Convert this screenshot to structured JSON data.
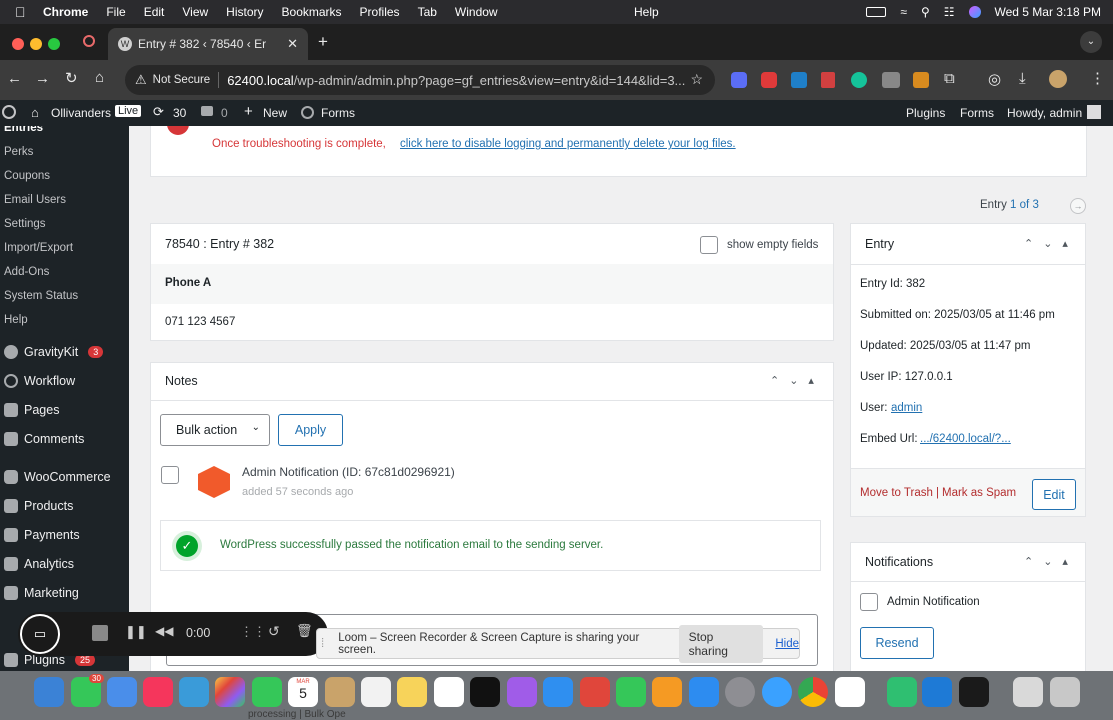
{
  "menubar": {
    "app_name": "Chrome",
    "items": [
      "File",
      "Edit",
      "View",
      "History",
      "Bookmarks",
      "Profiles",
      "Tab",
      "Window"
    ],
    "help": "Help",
    "datetime": "Wed 5 Mar  3:18 PM"
  },
  "browser": {
    "tab_title": "Entry # 382 ‹ 78540 ‹ Er",
    "security_label": "Not Secure",
    "url_host": "62400.local",
    "url_path": "/wp-admin/admin.php?page=gf_entries&view=entry&id=144&lid=3..."
  },
  "adminbar": {
    "site_name": "Ollivanders",
    "live_badge": "Live",
    "updates_count": "30",
    "comments_count": "0",
    "new_label": "New",
    "forms_label": "Forms",
    "right_plugins": "Plugins",
    "right_forms": "Forms",
    "howdy": "Howdy, admin"
  },
  "sidebar": {
    "submenu_current": "Entries",
    "submenu": [
      "Perks",
      "Coupons",
      "Email Users",
      "Settings",
      "Import/Export",
      "Add-Ons",
      "System Status",
      "Help"
    ],
    "menu": [
      {
        "label": "GravityKit",
        "badge": "3"
      },
      {
        "label": "Workflow",
        "badge": ""
      },
      {
        "label": "Pages",
        "badge": ""
      },
      {
        "label": "Comments",
        "badge": ""
      },
      {
        "label": "WooCommerce",
        "badge": ""
      },
      {
        "label": "Products",
        "badge": ""
      },
      {
        "label": "Payments",
        "badge": ""
      },
      {
        "label": "Analytics",
        "badge": ""
      },
      {
        "label": "Marketing",
        "badge": ""
      },
      {
        "label": "Plugins",
        "badge": "25"
      }
    ]
  },
  "notice": {
    "text": "Once troubleshooting is complete,",
    "link": "click here to disable logging and permanently delete your log files."
  },
  "pagination": {
    "prefix": "Entry",
    "current": "1",
    "of": "of",
    "total": "3"
  },
  "entry_box": {
    "title": "78540 : Entry # 382",
    "show_empty": "show empty fields",
    "field_label": "Phone A",
    "field_value": "071 123 4567"
  },
  "notes": {
    "title": "Notes",
    "bulk_action": "Bulk action",
    "apply": "Apply",
    "note_title": "Admin Notification (ID: 67c81d0296921)",
    "note_time": "added 57 seconds ago",
    "note_message": "WordPress successfully passed the notification email to the sending server."
  },
  "entry_info": {
    "title": "Entry",
    "entry_id": "Entry Id: 382",
    "submitted": "Submitted on: 2025/03/05 at 11:46 pm",
    "updated": "Updated: 2025/03/05 at 11:47 pm",
    "user_ip": "User IP: 127.0.0.1",
    "user_label": "User:",
    "user_link": "admin",
    "embed_label": "Embed Url:",
    "embed_link": ".../62400.local/?...",
    "trash": "Move to Trash",
    "sep": "|",
    "spam": "Mark as Spam",
    "edit": "Edit"
  },
  "notifications": {
    "title": "Notifications",
    "item": "Admin Notification",
    "resend": "Resend"
  },
  "loom": {
    "time": "0:00",
    "share_text": "Loom – Screen Recorder & Screen Capture is sharing your screen.",
    "stop": "Stop sharing",
    "hide": "Hide"
  },
  "dock": {
    "messages_badge": "30",
    "calendar_month": "MAR",
    "calendar_day": "5",
    "bottom_text": "processing | Bulk Ope"
  },
  "colors": {
    "wp_dark": "#1d2327",
    "wp_blue": "#2271b1",
    "danger": "#d63638",
    "success": "#00a32a"
  }
}
